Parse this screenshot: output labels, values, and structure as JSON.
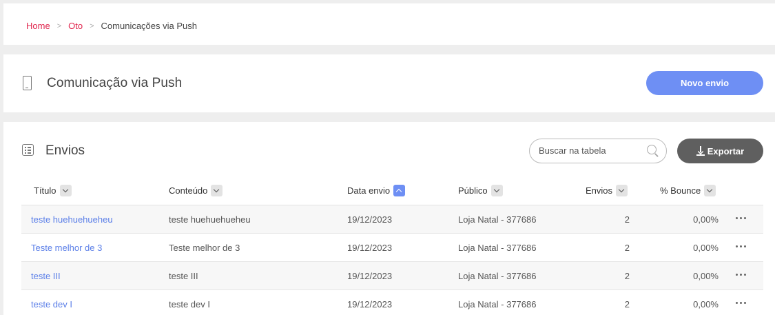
{
  "breadcrumb": {
    "items": [
      "Home",
      "Oto"
    ],
    "separator": ">",
    "current": "Comunicações via Push"
  },
  "header": {
    "title": "Comunicação via Push",
    "new_button": "Novo envio"
  },
  "section": {
    "title": "Envios",
    "search_placeholder": "Buscar na tabela",
    "export_button": "Exportar"
  },
  "table": {
    "columns": [
      "Título",
      "Conteúdo",
      "Data envio",
      "Público",
      "Envios",
      "% Bounce"
    ],
    "active_sort_column": "Data envio",
    "rows": [
      {
        "titulo": "teste huehuehueheu",
        "conteudo": "teste huehuehueheu",
        "data": "19/12/2023",
        "publico": "Loja Natal - 377686",
        "envios": "2",
        "bounce": "0,00%"
      },
      {
        "titulo": "Teste melhor de 3",
        "conteudo": "Teste melhor de 3",
        "data": "19/12/2023",
        "publico": "Loja Natal - 377686",
        "envios": "2",
        "bounce": "0,00%"
      },
      {
        "titulo": "teste III",
        "conteudo": "teste III",
        "data": "19/12/2023",
        "publico": "Loja Natal - 377686",
        "envios": "2",
        "bounce": "0,00%"
      },
      {
        "titulo": "teste dev I",
        "conteudo": "teste dev I",
        "data": "19/12/2023",
        "publico": "Loja Natal - 377686",
        "envios": "2",
        "bounce": "0,00%"
      }
    ]
  },
  "colors": {
    "accent": "#6e8ff4",
    "breadcrumb_link": "#e0254d",
    "link": "#5b7fe8",
    "export_button": "#5f5f5f"
  },
  "icons": [
    "phone-icon",
    "list-icon",
    "search-icon",
    "download-icon",
    "chevron-down-icon",
    "chevron-up-icon",
    "more-options-icon"
  ]
}
